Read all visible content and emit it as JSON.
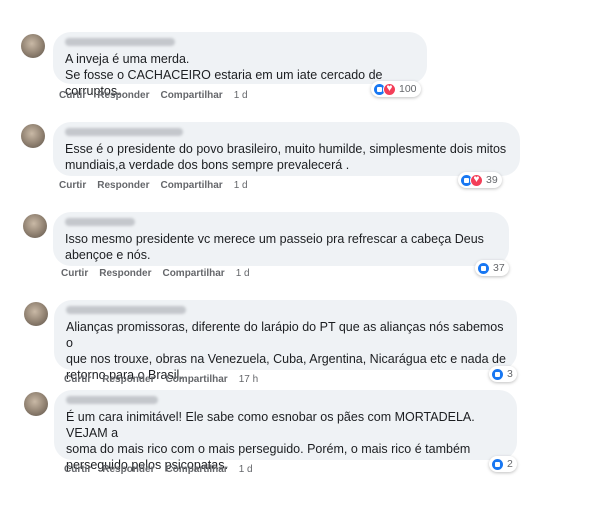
{
  "actions": {
    "like": "Curtir",
    "reply": "Responder",
    "share": "Compartilhar"
  },
  "colors": {
    "like": "#1877f2",
    "love": "#f33e58",
    "bubble": "#eff2f5"
  },
  "comments": [
    {
      "text": "A inveja é uma merda.\nSe fosse o CACHACEIRO estaria em um iate cercado de corruptos.",
      "time": "1 d",
      "reactions": [
        "like-icon",
        "love-icon"
      ],
      "count": "100"
    },
    {
      "text": "Esse é o presidente do povo brasileiro, muito humilde, simplesmente dois mitos\nmundiais,a verdade dos bons sempre prevalecerá .",
      "time": "1 d",
      "reactions": [
        "like-icon",
        "love-icon"
      ],
      "count": "39"
    },
    {
      "text": "Isso mesmo presidente vc merece um passeio pra refrescar a cabeça Deus\nabençoe e nós.",
      "time": "1 d",
      "reactions": [
        "like-icon"
      ],
      "count": "37"
    },
    {
      "text": "Alianças promissoras, diferente do larápio do PT que as alianças nós sabemos o\nque nos trouxe, obras na Venezuela, Cuba, Argentina, Nicarágua etc e nada de\nretorno para o Brasil.",
      "time": "17 h",
      "reactions": [
        "like-icon"
      ],
      "count": "3"
    },
    {
      "text": "É um cara inimitável! Ele sabe como esnobar os pães com MORTADELA. VEJAM a\nsoma do mais rico com o mais perseguido. Porém, o mais rico é também\nperseguido pelos psicopatas.",
      "time": "1 d",
      "reactions": [
        "like-icon"
      ],
      "count": "2"
    }
  ]
}
